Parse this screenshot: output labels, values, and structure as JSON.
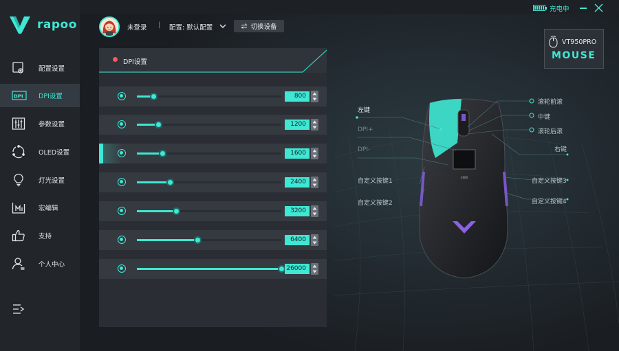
{
  "brand": {
    "name": "rapoo",
    "accent": "#3ee8d4"
  },
  "window": {
    "charge_status": "充电中"
  },
  "user": {
    "login_status": "未登录",
    "divider": "|",
    "config_label": "配置: 默认配置",
    "switch_device": "切换设备"
  },
  "device": {
    "model": "VT950PRO",
    "type": "MOUSE"
  },
  "sidebar": {
    "items": [
      {
        "label": "配置设置",
        "icon": "config-settings-icon"
      },
      {
        "label": "DPI设置",
        "icon": "dpi-icon"
      },
      {
        "label": "参数设置",
        "icon": "sliders-icon"
      },
      {
        "label": "OLED设置",
        "icon": "oled-icon"
      },
      {
        "label": "灯光设置",
        "icon": "lightbulb-icon"
      },
      {
        "label": "宏编辑",
        "icon": "macro-icon"
      },
      {
        "label": "支持",
        "icon": "thumbs-up-icon"
      },
      {
        "label": "个人中心",
        "icon": "user-icon"
      }
    ]
  },
  "panel": {
    "title": "DPI设置",
    "max_dpi": 26000,
    "rows": [
      {
        "value": "800",
        "level": 800
      },
      {
        "value": "1200",
        "level": 1200
      },
      {
        "value": "1600",
        "level": 1600,
        "active": true
      },
      {
        "value": "2400",
        "level": 2400
      },
      {
        "value": "3200",
        "level": 3200
      },
      {
        "value": "6400",
        "level": 6400
      },
      {
        "value": "26000",
        "level": 26000
      }
    ]
  },
  "mouse_labels": {
    "left_button": "左键",
    "dpi_plus": "DPI+",
    "dpi_minus": "DPI-",
    "custom1_left": "自定义按键1",
    "custom2_left": "自定义按键2",
    "wheel_forward": "滚轮前滚",
    "middle": "中键",
    "wheel_backward": "滚轮后滚",
    "right_button": "右键",
    "custom3": "自定义按键3",
    "custom4": "自定义按键4",
    "mouse_model_print": "2600"
  }
}
